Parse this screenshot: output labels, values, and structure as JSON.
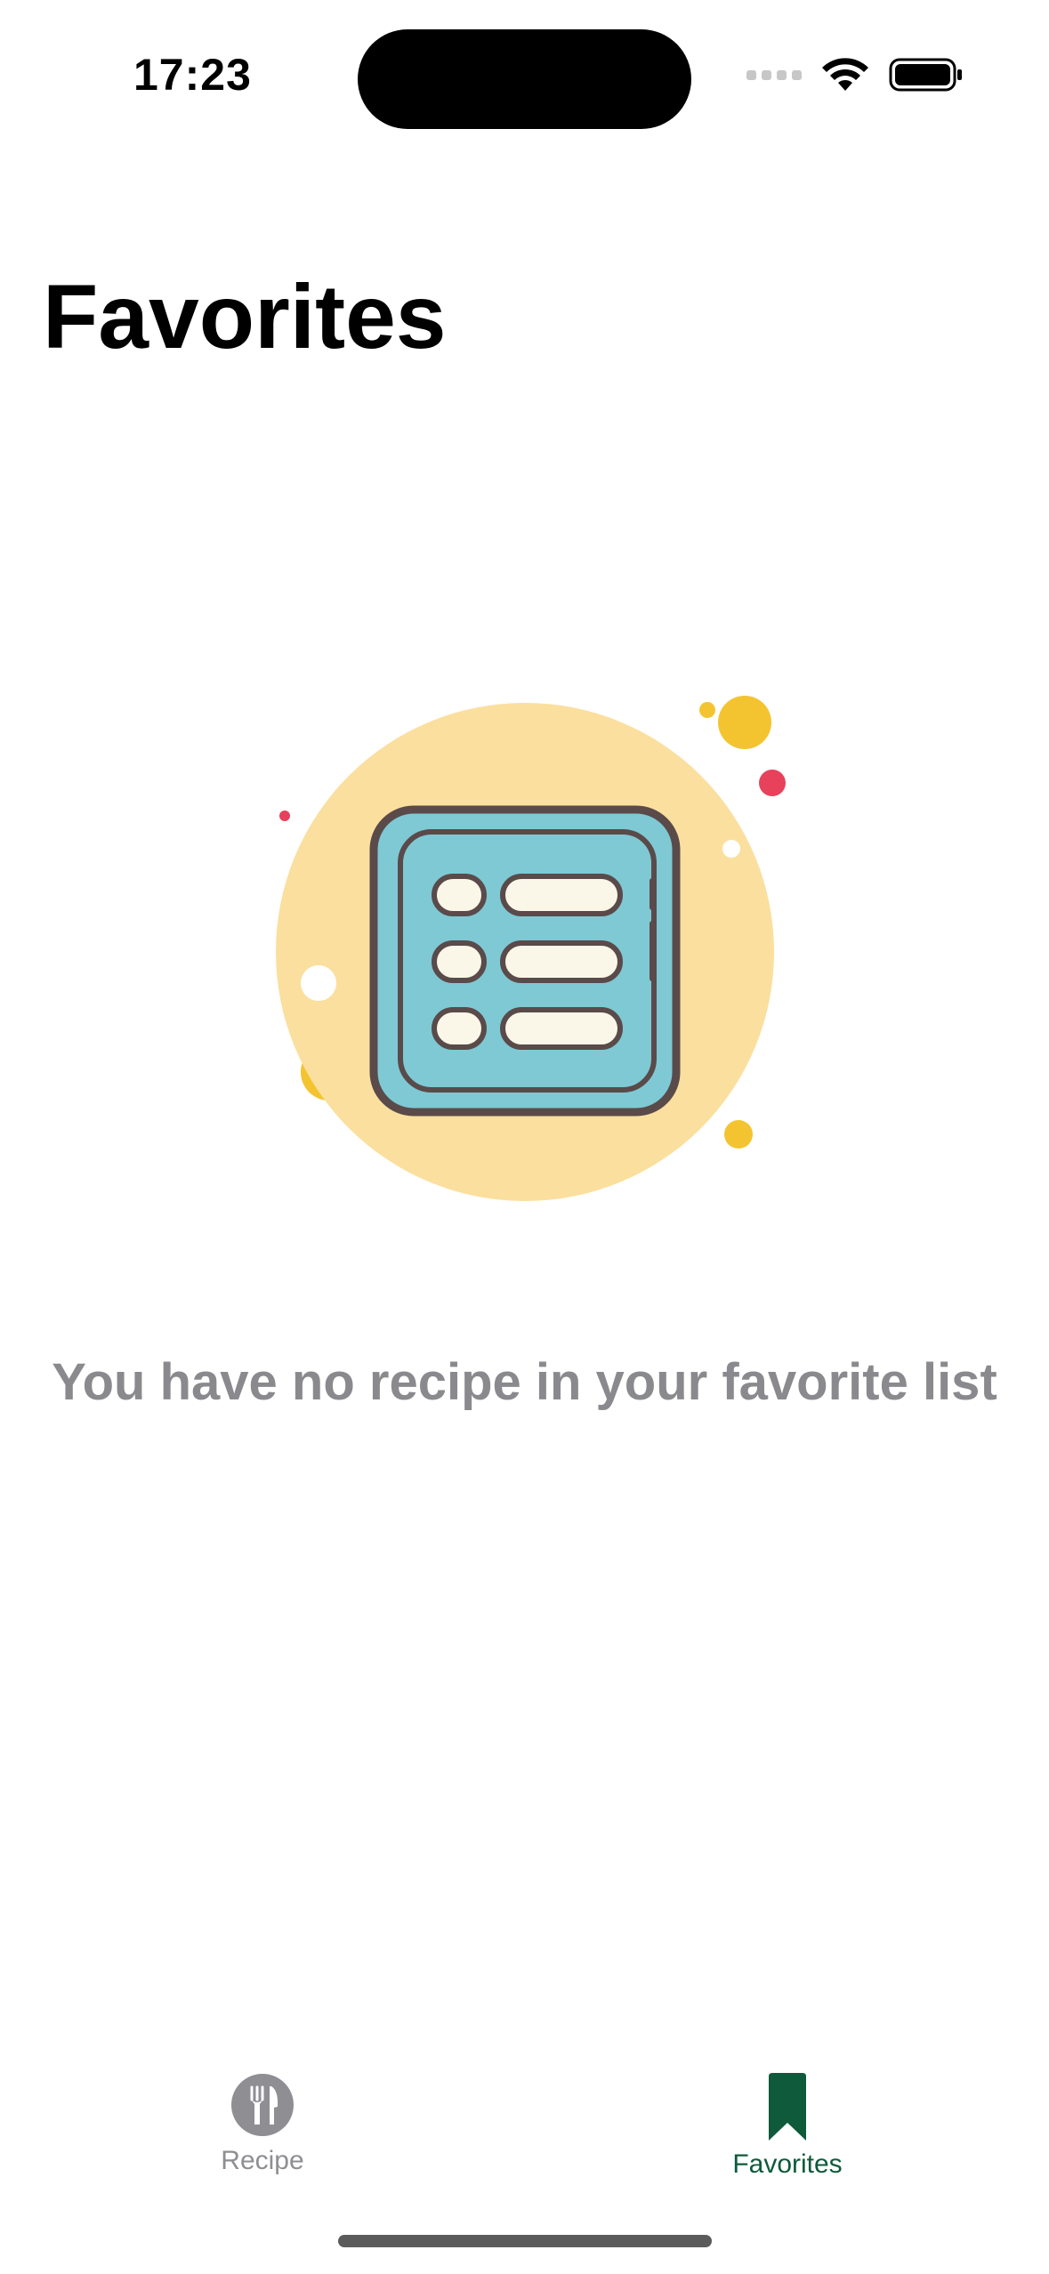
{
  "status_bar": {
    "time": "17:23"
  },
  "header": {
    "title": "Favorites"
  },
  "empty_state": {
    "illustration": "recipe-list-icon",
    "message": "You have no recipe in your favorite list"
  },
  "tab_bar": {
    "tabs": [
      {
        "label": "Recipe",
        "icon": "fork-knife-icon",
        "selected": false
      },
      {
        "label": "Favorites",
        "icon": "bookmark-icon",
        "selected": true
      }
    ]
  },
  "colors": {
    "accent": "#0e5a3a",
    "inactive": "#8e8e93",
    "message": "#8a8a8e",
    "illustration_bg": "#fbdf9e",
    "illustration_card": "#7ec9d4"
  }
}
